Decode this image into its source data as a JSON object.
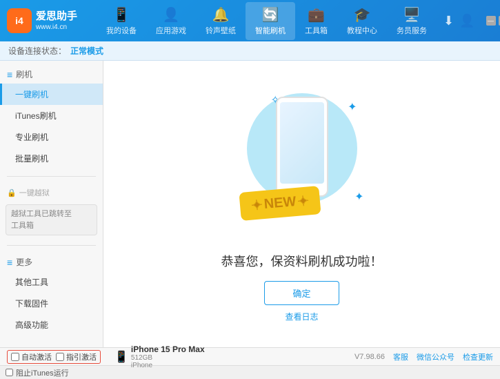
{
  "app": {
    "logo_text": "爱思助手",
    "logo_sub": "www.i4.cn",
    "logo_abbr": "i4"
  },
  "nav": {
    "tabs": [
      {
        "id": "my-device",
        "label": "我的设备",
        "icon": "📱"
      },
      {
        "id": "apps-games",
        "label": "应用游戏",
        "icon": "👤"
      },
      {
        "id": "ringtones",
        "label": "铃声壁纸",
        "icon": "🔔"
      },
      {
        "id": "smart-flash",
        "label": "智能刷机",
        "icon": "🔄",
        "active": true
      },
      {
        "id": "toolbox",
        "label": "工具箱",
        "icon": "💼"
      },
      {
        "id": "tutorials",
        "label": "教程中心",
        "icon": "🎓"
      },
      {
        "id": "service",
        "label": "务员服务",
        "icon": "🖥️"
      }
    ]
  },
  "status_bar": {
    "prefix": "设备连接状态：",
    "value": "正常模式"
  },
  "sidebar": {
    "flash_section": "刷机",
    "items": [
      {
        "id": "one-click-flash",
        "label": "一键刷机",
        "active": true
      },
      {
        "id": "itunes-flash",
        "label": "iTunes刷机"
      },
      {
        "id": "pro-flash",
        "label": "专业刷机"
      },
      {
        "id": "batch-flash",
        "label": "批量刷机"
      }
    ],
    "disabled_section": "一键越狱",
    "note_line1": "越狱工具已跳转至",
    "note_line2": "工具箱",
    "more_section": "更多",
    "more_items": [
      {
        "id": "other-tools",
        "label": "其他工具"
      },
      {
        "id": "download-fw",
        "label": "下载固件"
      },
      {
        "id": "advanced",
        "label": "高级功能"
      }
    ]
  },
  "content": {
    "success_message": "恭喜您，保资料刷机成功啦！",
    "confirm_label": "确定",
    "log_label": "查看日志"
  },
  "device": {
    "name": "iPhone 15 Pro Max",
    "storage": "512GB",
    "type": "iPhone"
  },
  "bottom": {
    "auto_activate_label": "自动激活",
    "guide_activate_label": "指引激活",
    "itunes_label": "阻止iTunes运行",
    "version": "V7.98.66",
    "links": [
      "客服",
      "微信公众号",
      "检查更新"
    ]
  },
  "new_badge": "NEW",
  "win_controls": {
    "min": "—",
    "max": "□",
    "close": "✕"
  }
}
